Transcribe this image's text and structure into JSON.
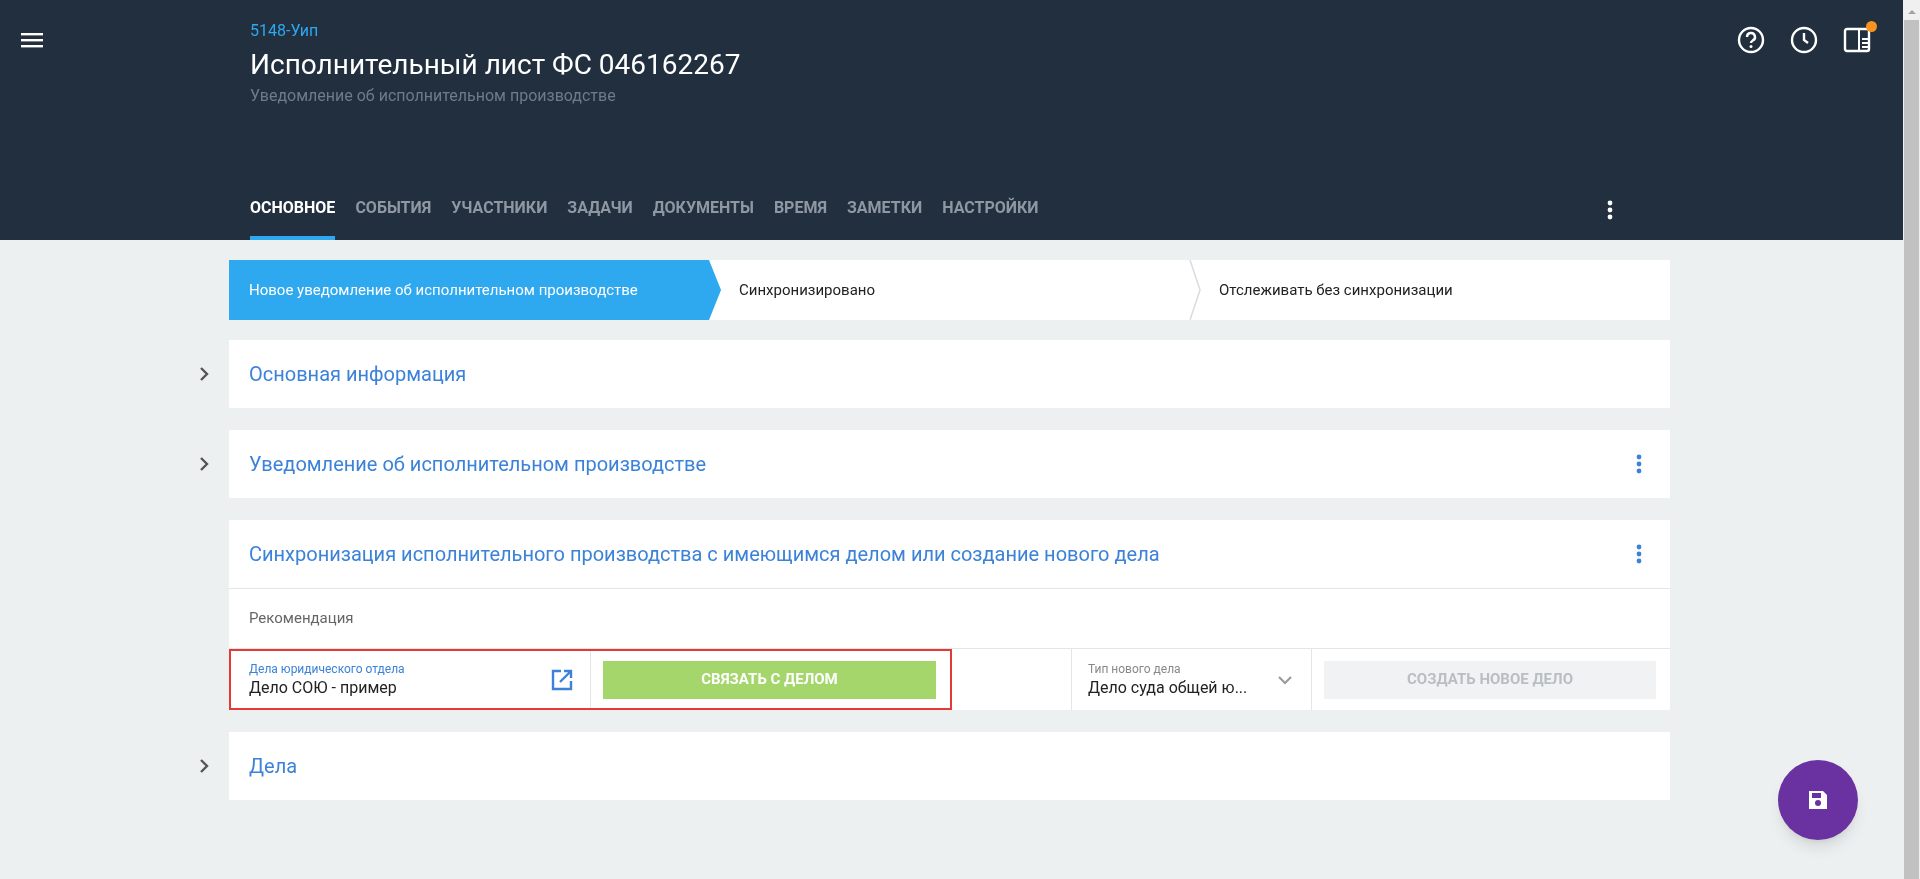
{
  "header": {
    "code": "5148-Уип",
    "title": "Исполнительный лист ФС 046162267",
    "subtitle": "Уведомление об исполнительном производстве",
    "notification": true
  },
  "tabs": [
    {
      "label": "ОСНОВНОЕ",
      "selected": true
    },
    {
      "label": "СОБЫТИЯ",
      "selected": false
    },
    {
      "label": "УЧАСТНИКИ",
      "selected": false
    },
    {
      "label": "ЗАДАЧИ",
      "selected": false
    },
    {
      "label": "ДОКУМЕНТЫ",
      "selected": false
    },
    {
      "label": "ВРЕМЯ",
      "selected": false
    },
    {
      "label": "ЗАМЕТКИ",
      "selected": false
    },
    {
      "label": "НАСТРОЙКИ",
      "selected": false
    }
  ],
  "stages": [
    {
      "label": "Новое уведомление об исполнительном производстве",
      "selected": true
    },
    {
      "label": "Синхронизировано",
      "selected": false
    },
    {
      "label": "Отслеживать без синхронизации",
      "selected": false
    }
  ],
  "sections": [
    {
      "title": "Основная информация",
      "expanded": false,
      "menu": false
    },
    {
      "title": "Уведомление об исполнительном производстве",
      "expanded": false,
      "menu": true
    },
    {
      "title": "Синхронизация исполнительного производства с имеющимся делом или создание нового дела",
      "expanded": true,
      "menu": true,
      "recommendation": "Рекомендация",
      "link_field": {
        "label": "Дела юридического отдела",
        "value": "Дело СОЮ - пример",
        "highlighted": true
      },
      "link_button": {
        "label": "СВЯЗАТЬ С ДЕЛОМ",
        "disabled": false
      },
      "type_field": {
        "label": "Тип нового дела",
        "value": "Дело суда общей ю..."
      },
      "create_button": {
        "label": "СОЗДАТЬ НОВОЕ ДЕЛО",
        "disabled": true
      }
    },
    {
      "title": "Дела",
      "expanded": false,
      "menu": false
    }
  ]
}
